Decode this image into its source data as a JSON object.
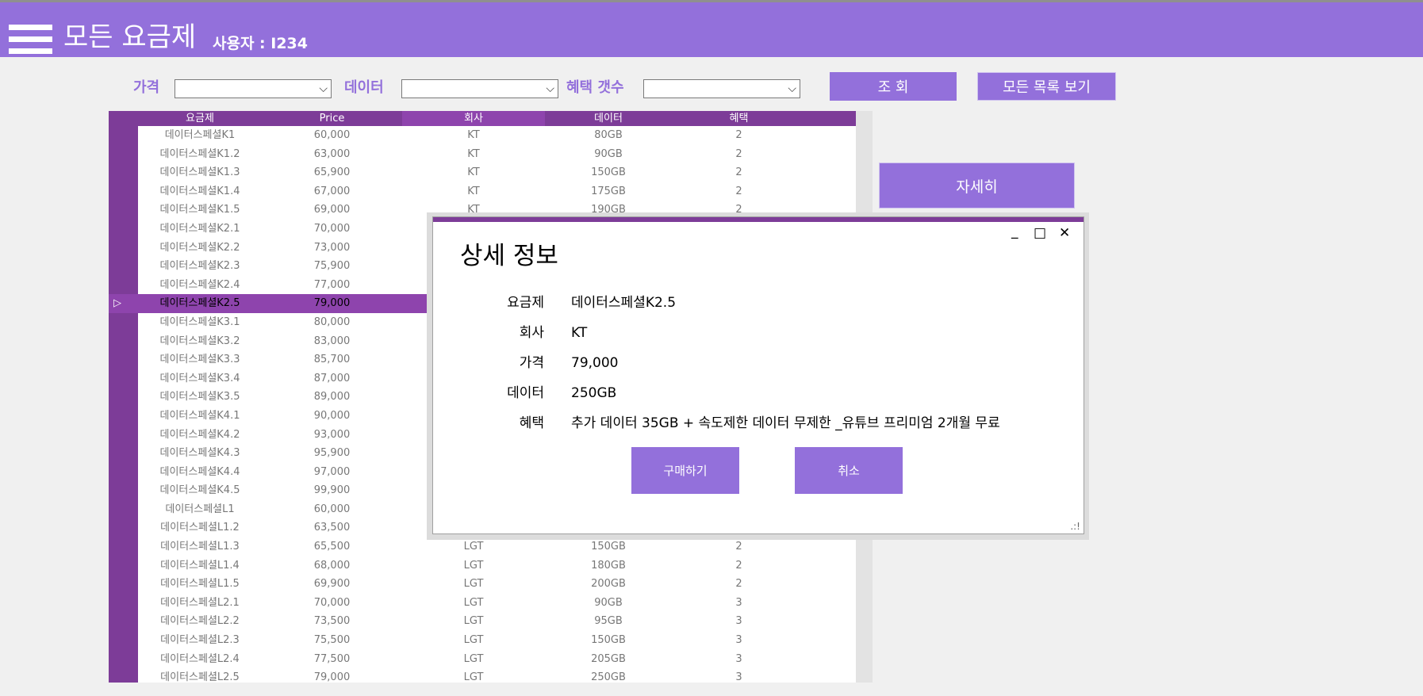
{
  "header": {
    "title": "모든 요금제",
    "user_label": "사용자 : I234"
  },
  "filters": {
    "price_label": "가격",
    "data_label": "데이터",
    "benefit_label": "혜택 갯수",
    "price_value": "",
    "data_value": "",
    "benefit_value": ""
  },
  "buttons": {
    "search": "조 회",
    "view_all": "모든 목록 보기",
    "detail": "자세히"
  },
  "grid": {
    "columns": [
      "요금제",
      "Price",
      "회사",
      "데이터",
      "혜택"
    ],
    "selected_marker": "▷",
    "rows": [
      {
        "plan": "데이터스페셜K1",
        "price": "60,000",
        "company": "KT",
        "data": "80GB",
        "benefit": "2"
      },
      {
        "plan": "데이터스페셜K1.2",
        "price": "63,000",
        "company": "KT",
        "data": "90GB",
        "benefit": "2"
      },
      {
        "plan": "데이터스페셜K1.3",
        "price": "65,900",
        "company": "KT",
        "data": "150GB",
        "benefit": "2"
      },
      {
        "plan": "데이터스페셜K1.4",
        "price": "67,000",
        "company": "KT",
        "data": "175GB",
        "benefit": "2"
      },
      {
        "plan": "데이터스페셜K1.5",
        "price": "69,000",
        "company": "KT",
        "data": "190GB",
        "benefit": "2"
      },
      {
        "plan": "데이터스페셜K2.1",
        "price": "70,000",
        "company": "",
        "data": "",
        "benefit": ""
      },
      {
        "plan": "데이터스페셜K2.2",
        "price": "73,000",
        "company": "",
        "data": "",
        "benefit": ""
      },
      {
        "plan": "데이터스페셜K2.3",
        "price": "75,900",
        "company": "",
        "data": "",
        "benefit": ""
      },
      {
        "plan": "데이터스페셜K2.4",
        "price": "77,000",
        "company": "",
        "data": "",
        "benefit": ""
      },
      {
        "plan": "데이터스페셜K2.5",
        "price": "79,000",
        "company": "",
        "data": "",
        "benefit": "",
        "selected": true
      },
      {
        "plan": "데이터스페셜K3.1",
        "price": "80,000",
        "company": "",
        "data": "",
        "benefit": ""
      },
      {
        "plan": "데이터스페셜K3.2",
        "price": "83,000",
        "company": "",
        "data": "",
        "benefit": ""
      },
      {
        "plan": "데이터스페셜K3.3",
        "price": "85,700",
        "company": "",
        "data": "",
        "benefit": ""
      },
      {
        "plan": "데이터스페셜K3.4",
        "price": "87,000",
        "company": "",
        "data": "",
        "benefit": ""
      },
      {
        "plan": "데이터스페셜K3.5",
        "price": "89,000",
        "company": "",
        "data": "",
        "benefit": ""
      },
      {
        "plan": "데이터스페셜K4.1",
        "price": "90,000",
        "company": "",
        "data": "",
        "benefit": ""
      },
      {
        "plan": "데이터스페셜K4.2",
        "price": "93,000",
        "company": "",
        "data": "",
        "benefit": ""
      },
      {
        "plan": "데이터스페셜K4.3",
        "price": "95,900",
        "company": "",
        "data": "",
        "benefit": ""
      },
      {
        "plan": "데이터스페셜K4.4",
        "price": "97,000",
        "company": "",
        "data": "",
        "benefit": ""
      },
      {
        "plan": "데이터스페셜K4.5",
        "price": "99,900",
        "company": "",
        "data": "",
        "benefit": ""
      },
      {
        "plan": "데이터스페셜L1",
        "price": "60,000",
        "company": "",
        "data": "",
        "benefit": ""
      },
      {
        "plan": "데이터스페셜L1.2",
        "price": "63,500",
        "company": "",
        "data": "",
        "benefit": ""
      },
      {
        "plan": "데이터스페셜L1.3",
        "price": "65,500",
        "company": "LGT",
        "data": "150GB",
        "benefit": "2"
      },
      {
        "plan": "데이터스페셜L1.4",
        "price": "68,000",
        "company": "LGT",
        "data": "180GB",
        "benefit": "2"
      },
      {
        "plan": "데이터스페셜L1.5",
        "price": "69,900",
        "company": "LGT",
        "data": "200GB",
        "benefit": "2"
      },
      {
        "plan": "데이터스페셜L2.1",
        "price": "70,000",
        "company": "LGT",
        "data": "90GB",
        "benefit": "3"
      },
      {
        "plan": "데이터스페셜L2.2",
        "price": "73,500",
        "company": "LGT",
        "data": "95GB",
        "benefit": "3"
      },
      {
        "plan": "데이터스페셜L2.3",
        "price": "75,500",
        "company": "LGT",
        "data": "150GB",
        "benefit": "3"
      },
      {
        "plan": "데이터스페셜L2.4",
        "price": "77,500",
        "company": "LGT",
        "data": "205GB",
        "benefit": "3"
      },
      {
        "plan": "데이터스페셜L2.5",
        "price": "79,000",
        "company": "LGT",
        "data": "250GB",
        "benefit": "3"
      }
    ]
  },
  "dialog": {
    "title": "상세 정보",
    "window_controls": {
      "minimize": "_",
      "maximize": "□",
      "close": "✕"
    },
    "fields": [
      {
        "label": "요금제",
        "value": "데이터스페셜K2.5"
      },
      {
        "label": "회사",
        "value": "KT"
      },
      {
        "label": "가격",
        "value": "79,000"
      },
      {
        "label": "데이터",
        "value": "250GB"
      },
      {
        "label": "혜택",
        "value": "추가 데이터 35GB + 속도제한 데이터 무제한 _유튜브 프리미엄 2개월 무료"
      }
    ],
    "buy_label": "구매하기",
    "cancel_label": "취소",
    "grip": ".:!"
  },
  "colors": {
    "accent": "#9370db",
    "dark_purple": "#7d3c98",
    "selected_row": "#8e44ad"
  },
  "icons": {
    "menu": "hamburger-menu-icon",
    "dropdown": "chevron-down-icon",
    "row_marker": "play-triangle-icon"
  }
}
